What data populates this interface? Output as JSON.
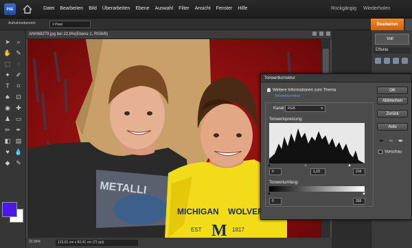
{
  "app": {
    "logo": "PSE"
  },
  "menu": [
    "Datei",
    "Bearbeiten",
    "Bild",
    "Überarbeiten",
    "Ebene",
    "Auswahl",
    "Filter",
    "Ansicht",
    "Fenster",
    "Hilfe"
  ],
  "undo": {
    "undo_label": "Rückgängig",
    "redo_label": "Wiederholen"
  },
  "options": {
    "label": "Aufnahmebereich:",
    "value": "1 Pixel"
  },
  "mode_tab": {
    "label": "Bearbeiten"
  },
  "document": {
    "title": "ANH68279.jpg bei 22,6%(Ebene 1, RGB/8)",
    "zoom": "22,56%",
    "dimensions": "123,61 cm x 82,41 cm (72 ppi)"
  },
  "panel": {
    "view_label": "Voll",
    "effects_label": "Effekte"
  },
  "colors": {
    "foreground": "#4a18ea",
    "background": "#ffffff"
  },
  "dialog": {
    "title": "Tonwertkorrektur",
    "info": "Weitere Informationen zum Thema",
    "link": "Tonwertkorrektur",
    "ok": "OK",
    "cancel": "Abbrechen",
    "reset": "Zurück",
    "auto": "Auto",
    "preview": "Vorschau",
    "channel_label": "Kanal:",
    "channel_value": "RGB",
    "input_levels_label": "Tonwertspreizung:",
    "input_black": "0",
    "input_gamma": "1,23",
    "input_white": "216",
    "output_levels_label": "Tonwertumfang:",
    "output_black": "0",
    "output_white": "255"
  }
}
